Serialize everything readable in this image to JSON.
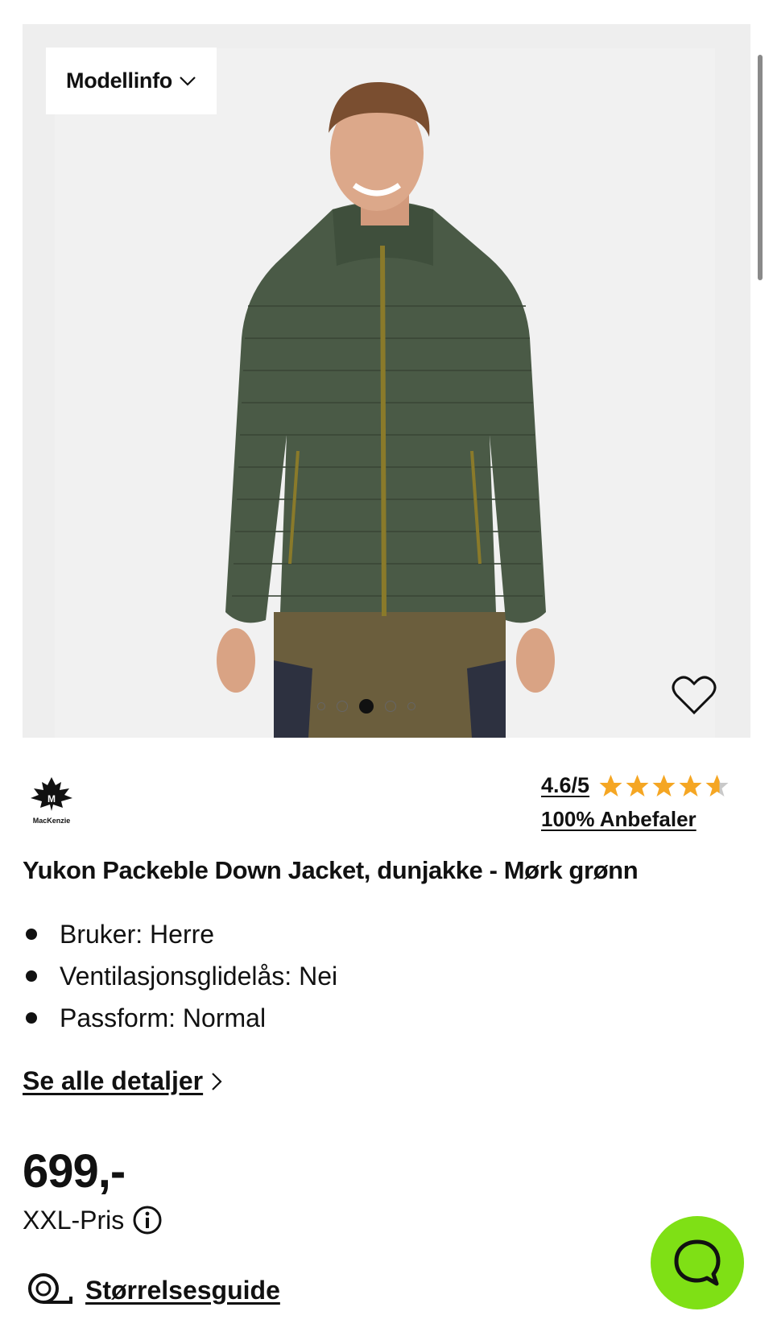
{
  "gallery": {
    "model_info_label": "Modellinfo",
    "image_count": 5,
    "active_image_index": 3,
    "favorite_icon": "heart-icon"
  },
  "brand": {
    "name": "MacKenzie",
    "logo_icon": "maple-leaf-icon"
  },
  "rating": {
    "score_text": "4.6/5",
    "value": 4.6,
    "max": 5,
    "star_color": "#f5a623",
    "recommend_text": "100% Anbefaler"
  },
  "product": {
    "title": "Yukon Packeble Down Jacket, dunjakke - Mørk grønn",
    "features": [
      "Bruker: Herre",
      "Ventilasjonsglidelås: Nei",
      "Passform: Normal"
    ],
    "details_link": "Se alle detaljer"
  },
  "pricing": {
    "price": "699,-",
    "price_type": "XXL-Pris"
  },
  "size_guide": {
    "label": "Størrelsesguide",
    "icon": "measuring-tape-icon"
  },
  "chat": {
    "icon": "chat-bubble-icon",
    "color": "#7fe015"
  }
}
